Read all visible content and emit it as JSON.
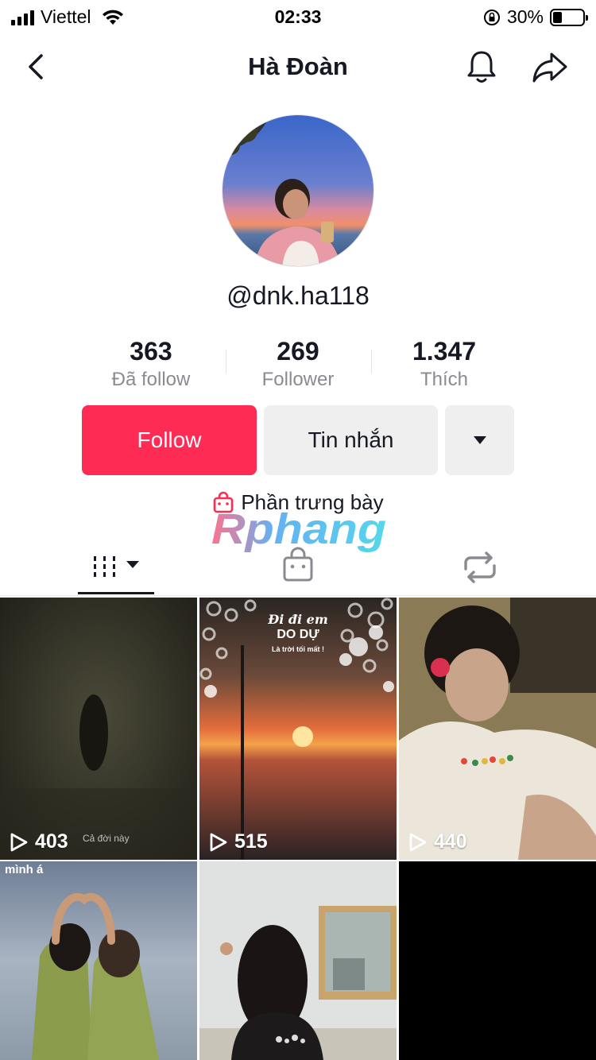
{
  "status_bar": {
    "carrier": "Viettel",
    "time": "02:33",
    "battery_percent": "30%",
    "battery_level": 0.3
  },
  "nav": {
    "title": "Hà Đoàn"
  },
  "profile": {
    "username": "@dnk.ha118",
    "stats": [
      {
        "value": "363",
        "label": "Đã follow"
      },
      {
        "value": "269",
        "label": "Follower"
      },
      {
        "value": "1.347",
        "label": "Thích"
      }
    ],
    "follow_label": "Follow",
    "message_label": "Tin nhắn",
    "showcase_label": "Phần trưng bày"
  },
  "watermark": {
    "text": "Rphang"
  },
  "tabs": [
    {
      "icon": "videos-grid-icon",
      "active": true
    },
    {
      "icon": "shopping-bag-icon",
      "active": false
    },
    {
      "icon": "repost-icon",
      "active": false
    }
  ],
  "videos": [
    {
      "views": "403",
      "caption": "Cả đời này"
    },
    {
      "views": "515",
      "overlay_title": "Đi đi em",
      "overlay_subtitle": "DO DỰ",
      "overlay_small": "Là trời tối mất !"
    },
    {
      "views": "440"
    },
    {
      "caption": "mình á"
    },
    {},
    {}
  ],
  "colors": {
    "accent": "#fe2c55",
    "text": "#161823",
    "muted": "#8a8b91",
    "button_gray": "#efeff0"
  }
}
